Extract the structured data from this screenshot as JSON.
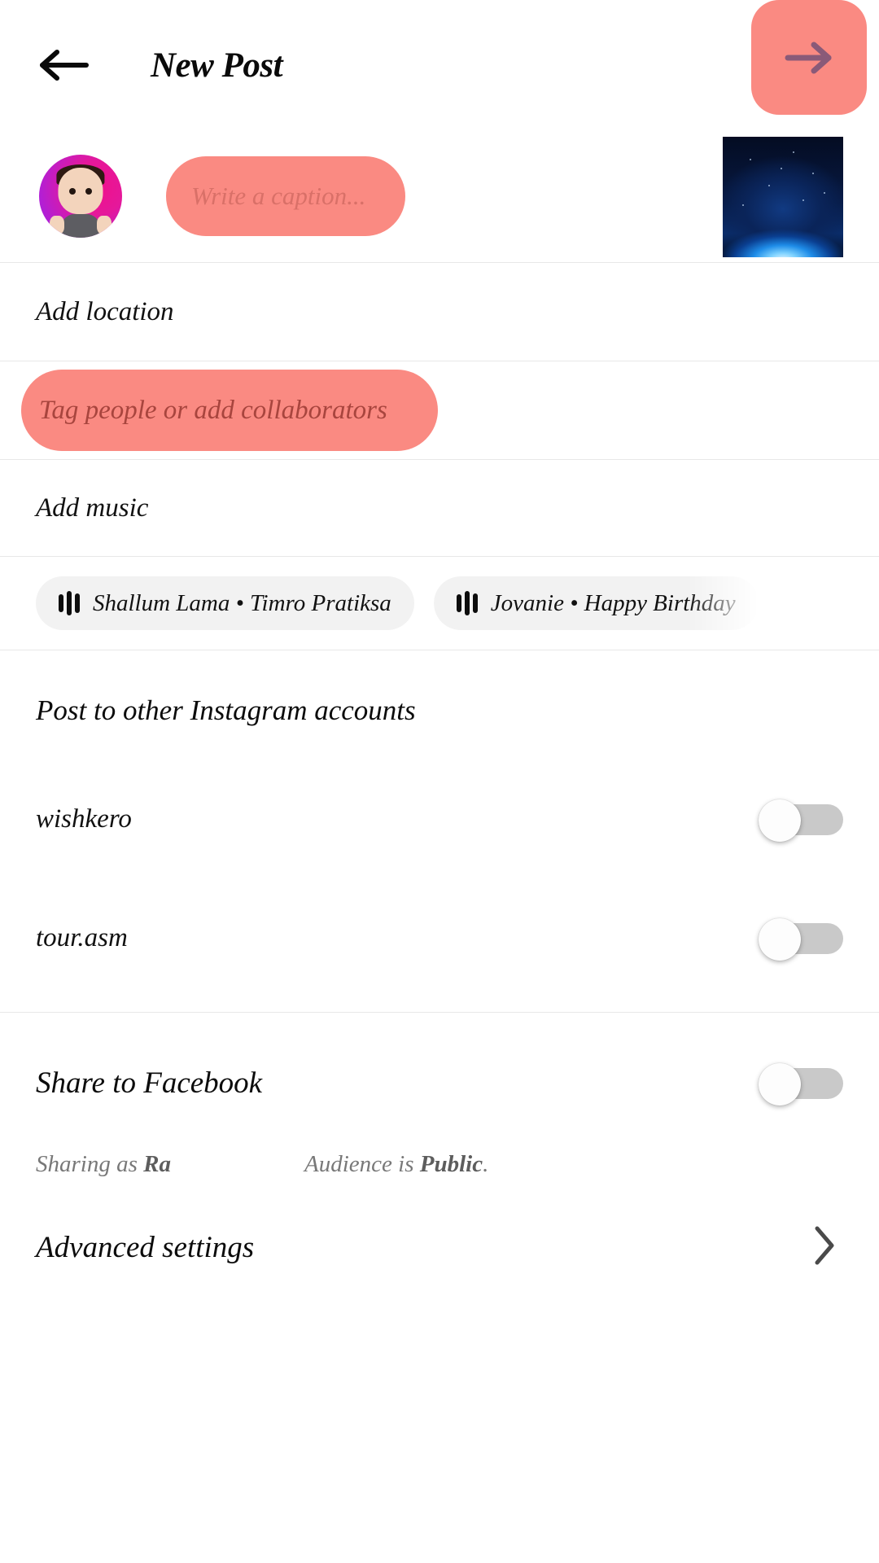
{
  "header": {
    "title": "New Post",
    "back_icon": "arrow-left-icon",
    "next_icon": "arrow-right-icon",
    "next_button_color": "#FA8A82",
    "next_arrow_color": "#8A5A78"
  },
  "caption": {
    "placeholder": "Write a caption...",
    "avatar_label": "user-avatar",
    "highlight_color": "#FA8A82",
    "media_thumbnail_label": "selected-media-thumbnail"
  },
  "location": {
    "label": "Add location"
  },
  "tag": {
    "label": "Tag people or add collaborators",
    "highlight_color": "#FA8A82"
  },
  "music": {
    "label": "Add music",
    "suggestions": [
      {
        "icon": "music-equalizer-icon",
        "label": "Shallum Lama • Timro Pratiksa"
      },
      {
        "icon": "music-equalizer-icon",
        "label": "Jovanie • Happy Birthday"
      }
    ]
  },
  "other_accounts": {
    "title": "Post to other Instagram accounts",
    "accounts": [
      {
        "name": "wishkero",
        "toggle_state": "off"
      },
      {
        "name": "tour.asm",
        "toggle_state": "off"
      }
    ]
  },
  "facebook": {
    "label": "Share to Facebook",
    "toggle_state": "off",
    "sharing_as_prefix": "Sharing as ",
    "sharing_as_value": "Ra",
    "audience_prefix": "Audience is ",
    "audience_value": "Public",
    "audience_suffix": "."
  },
  "advanced": {
    "label": "Advanced settings",
    "chevron_icon": "chevron-right-icon"
  }
}
